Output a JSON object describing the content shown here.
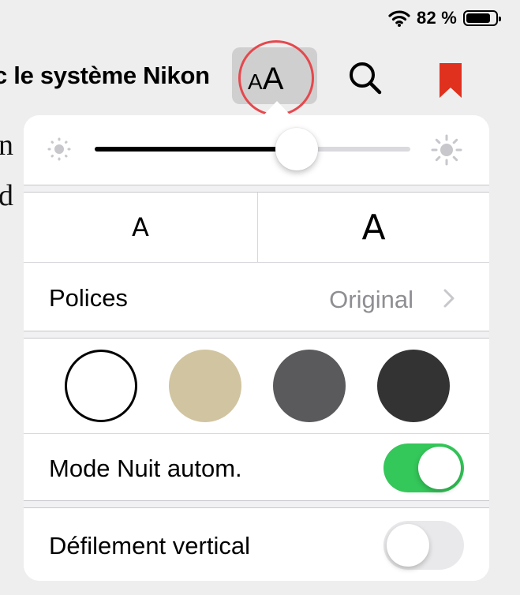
{
  "status_bar": {
    "battery_percent": "82 %",
    "battery_level": 0.82,
    "icons": [
      "wifi-icon",
      "battery-icon"
    ]
  },
  "toolbar": {
    "book_title": "c le système Nikon",
    "text_size_button": {
      "small": "A",
      "large": "A"
    },
    "icons": [
      "text-size-icon",
      "search-icon",
      "bookmark-icon"
    ],
    "bookmark_color": "#e0301e",
    "highlight_color": "#e5484d"
  },
  "background_text": {
    "line1": "n",
    "line2": "d"
  },
  "appearance": {
    "brightness": {
      "level": 0.64,
      "icons": [
        "brightness-low-icon",
        "brightness-high-icon"
      ]
    },
    "font_size": {
      "decrease": "A",
      "increase": "A"
    },
    "fonts": {
      "label": "Polices",
      "value": "Original"
    },
    "themes": [
      {
        "name": "white",
        "color": "#ffffff",
        "selected": true
      },
      {
        "name": "sepia",
        "color": "#d1c4a1",
        "selected": false
      },
      {
        "name": "gray",
        "color": "#5a5a5c",
        "selected": false
      },
      {
        "name": "night",
        "color": "#333333",
        "selected": false
      }
    ],
    "auto_night": {
      "label": "Mode Nuit autom.",
      "on": true,
      "on_color": "#34c759"
    },
    "vertical_scroll": {
      "label": "Défilement vertical",
      "on": false
    }
  }
}
